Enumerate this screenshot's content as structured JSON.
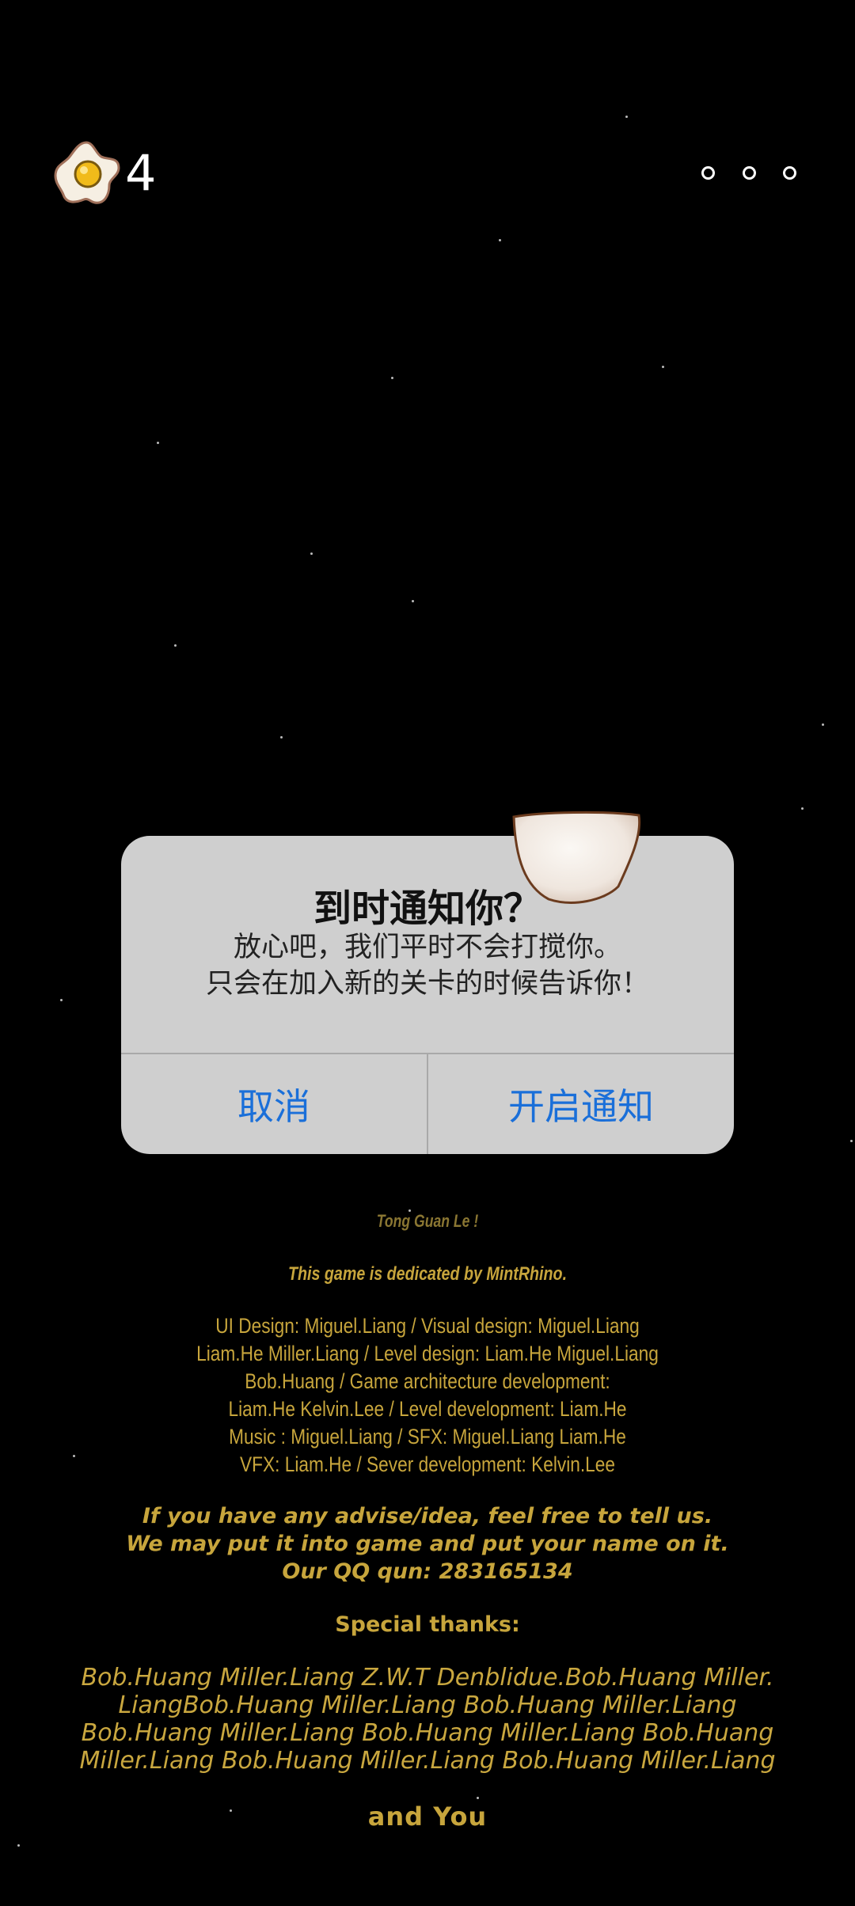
{
  "hud": {
    "egg_count": "4",
    "egg_icon": "fried-egg-icon",
    "menu_icon": "more-dots-icon"
  },
  "dialog": {
    "title": "到时通知你？",
    "message_line1": "放心吧，我们平时不会打搅你。",
    "message_line2": "只会在加入新的关卡的时候告诉你！",
    "cancel_label": "取消",
    "enable_label": "开启通知"
  },
  "credits": {
    "header": "Tong Guan Le !",
    "dedication": "This game is dedicated by MintRhino.",
    "roles": [
      "UI Design: Miguel.Liang / Visual design: Miguel.Liang",
      "Liam.He Miller.Liang / Level design: Liam.He Miguel.Liang",
      "Bob.Huang /  Game architecture development:",
      "Liam.He Kelvin.Lee / Level development: Liam.He",
      "Music : Miguel.Liang / SFX: Miguel.Liang Liam.He",
      "VFX: Liam.He / Sever development: Kelvin.Lee"
    ],
    "advise_line1": "If you have any advise/idea, feel free to tell us.",
    "advise_line2": "We may put it into game and put your name on it.",
    "qq_line": "Our QQ qun: 283165134",
    "special_thanks": "Special thanks:",
    "names": [
      "Bob.Huang Miller.Liang Z.W.T Denblidue.Bob.Huang Miller.",
      "LiangBob.Huang Miller.Liang Bob.Huang Miller.Liang",
      "Bob.Huang Miller.Liang Bob.Huang Miller.Liang Bob.Huang",
      "Miller.Liang Bob.Huang Miller.Liang Bob.Huang Miller.Liang"
    ],
    "and_you": "and You"
  },
  "colors": {
    "background": "#000000",
    "dialog_bg": "#cfcfcf",
    "button_text": "#1a6fd9",
    "credits_gold": "#c7a53c"
  }
}
